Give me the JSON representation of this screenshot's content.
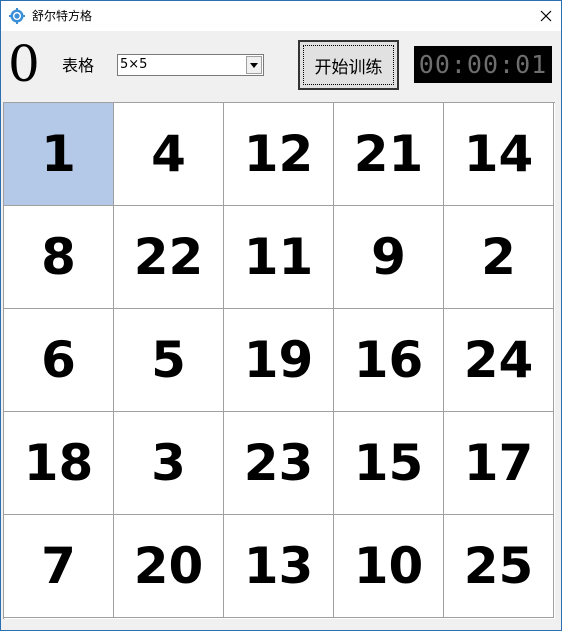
{
  "window": {
    "title": "舒尔特方格",
    "close_glyph": "✕"
  },
  "toolbar": {
    "counter": "0",
    "grid_label": "表格",
    "grid_size": {
      "selected": "5×5"
    },
    "start_button_label": "开始训练",
    "timer": "00:00:01"
  },
  "board": {
    "highlighted_index": 0,
    "cells": [
      "1",
      "4",
      "12",
      "21",
      "14",
      "8",
      "22",
      "11",
      "9",
      "2",
      "6",
      "5",
      "19",
      "16",
      "24",
      "18",
      "3",
      "23",
      "15",
      "17",
      "7",
      "20",
      "13",
      "10",
      "25"
    ]
  },
  "colors": {
    "highlight": "#b4c8e8",
    "timer_bg": "#000000",
    "timer_fg": "#6e6e6e",
    "window_border": "#2b6fb3"
  }
}
